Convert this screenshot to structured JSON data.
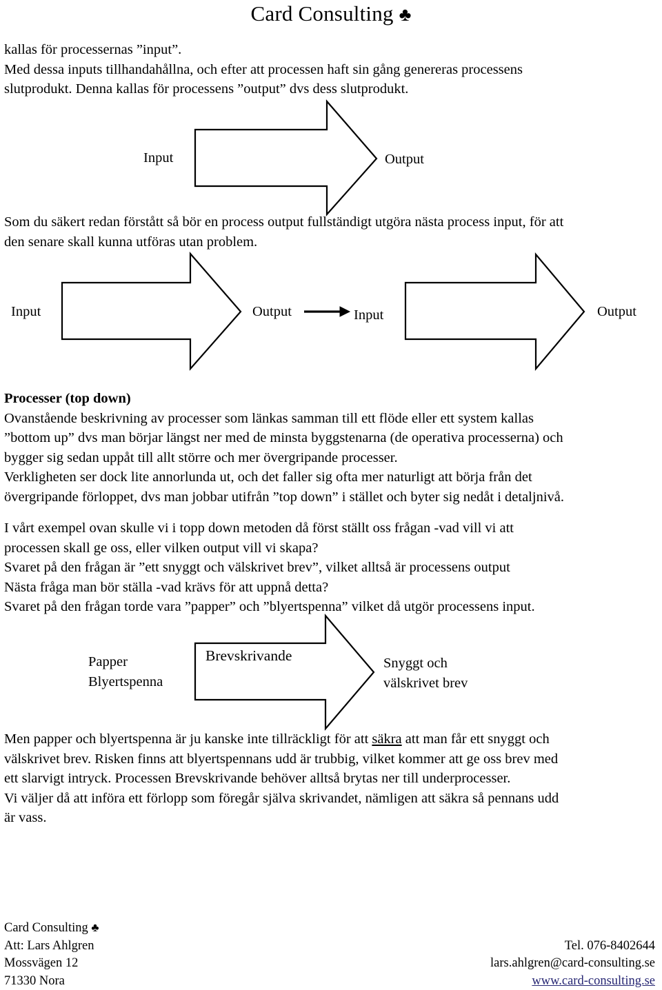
{
  "header": {
    "title": "Card Consulting",
    "club_symbol": "♣"
  },
  "paragraphs": {
    "intro": [
      "kallas för processernas ”input”.",
      "Med dessa inputs tillhandahållna, och efter att processen haft sin gång genereras processens",
      "slutprodukt. Denna kallas för processens ”output” dvs dess slutprodukt."
    ],
    "chain": [
      "Som du säkert redan förstått så bör en process output fullständigt utgöra nästa process input, för att",
      "den senare skall kunna utföras utan problem."
    ],
    "topdown_heading": "Processer (top down)",
    "topdown": [
      "Ovanstående beskrivning av processer som länkas samman till ett flöde eller ett system kallas",
      "”bottom up” dvs man börjar längst ner med de minsta byggstenarna (de operativa processerna) och",
      "bygger sig sedan uppåt till allt större och mer övergripande processer.",
      "Verkligheten ser dock lite annorlunda ut, och det faller sig ofta mer naturligt att börja från det",
      "övergripande förloppet, dvs man jobbar utifrån ”top down” i stället och byter sig nedåt i detaljnivå."
    ],
    "example": [
      "I vårt exempel ovan skulle vi i topp down metoden då först ställt oss frågan -vad vill vi att",
      "processen skall ge oss, eller vilken output vill vi skapa?",
      "Svaret på den frågan är ”ett snyggt och välskrivet brev”, vilket alltså är processens output",
      "Nästa fråga man bör ställa -vad krävs för att uppnå detta?",
      "Svaret på den frågan torde vara ”papper” och ”blyertspenna” vilket då utgör processens input."
    ],
    "underprocess": {
      "line1_a": "Men papper och blyertspenna är ju kanske inte tillräckligt för att ",
      "line1_u": "säkra",
      "line1_b": " att man får ett snyggt och",
      "line2": "välskrivet brev. Risken finns att blyertspennans udd är trubbig, vilket kommer att ge oss brev med",
      "line3": "ett slarvigt intryck. Processen Brevskrivande behöver alltså brytas ner till underprocesser.",
      "line4": "Vi väljer då att införa ett förlopp som föregår själva skrivandet, nämligen att säkra så pennans udd",
      "line5": "är vass."
    }
  },
  "diagram1": {
    "input_label": "Input",
    "output_label": "Output"
  },
  "diagram2": {
    "input1_label": "Input",
    "output1_label": "Output",
    "input2_label": "Input",
    "output2_label": "Output"
  },
  "diagram3": {
    "input_line1": "Papper",
    "input_line2": "Blyertspenna",
    "process_label": "Brevskrivande",
    "output_line1": "Snyggt och",
    "output_line2": "välskrivet brev"
  },
  "footer": {
    "company": "Card Consulting",
    "club_symbol": "♣",
    "attn": "Att: Lars Ahlgren",
    "street": "Mossvägen 12",
    "city": "71330 Nora",
    "phone": "Tel. 076-8402644",
    "email": "lars.ahlgren@card-consulting.se",
    "website": "www.card-consulting.se",
    "link_color": "#262673"
  }
}
